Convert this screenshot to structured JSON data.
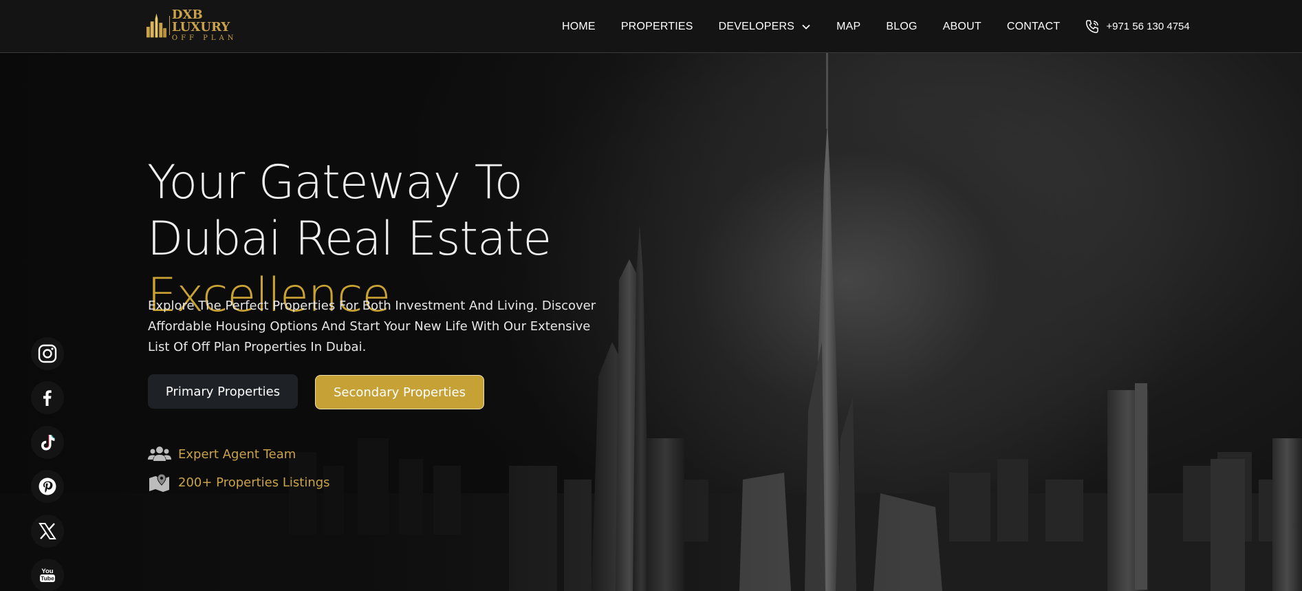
{
  "brand": {
    "title": "DXB LUXURY",
    "subtitle": "OFF PLAN"
  },
  "nav": {
    "items": [
      "HOME",
      "PROPERTIES",
      "DEVELOPERS",
      "MAP",
      "BLOG",
      "ABOUT",
      "CONTACT"
    ],
    "phone": "+971 56 130 4754"
  },
  "hero": {
    "line1": "Your Gateway To",
    "line2": "Dubai Real Estate",
    "line3": "Excellence",
    "description": "Explore The Perfect Properties For Both Investment And Living. Discover Affordable Housing Options And Start Your New Life With Our Extensive List Of Off Plan Properties In Dubai.",
    "primary_button": "Primary Properties",
    "secondary_button": "Secondary Properties",
    "feature1": "Expert Agent Team",
    "feature2": "200+ Properties Listings"
  },
  "social": {
    "icons": [
      "instagram-icon",
      "facebook-icon",
      "tiktok-icon",
      "pinterest-icon",
      "x-icon",
      "youtube-icon"
    ],
    "youtube_text_1": "You",
    "youtube_text_2": "Tube"
  },
  "colors": {
    "accent_gold": "#c9a233",
    "button_gold": "#c6a236",
    "header_bg": "#141414"
  }
}
